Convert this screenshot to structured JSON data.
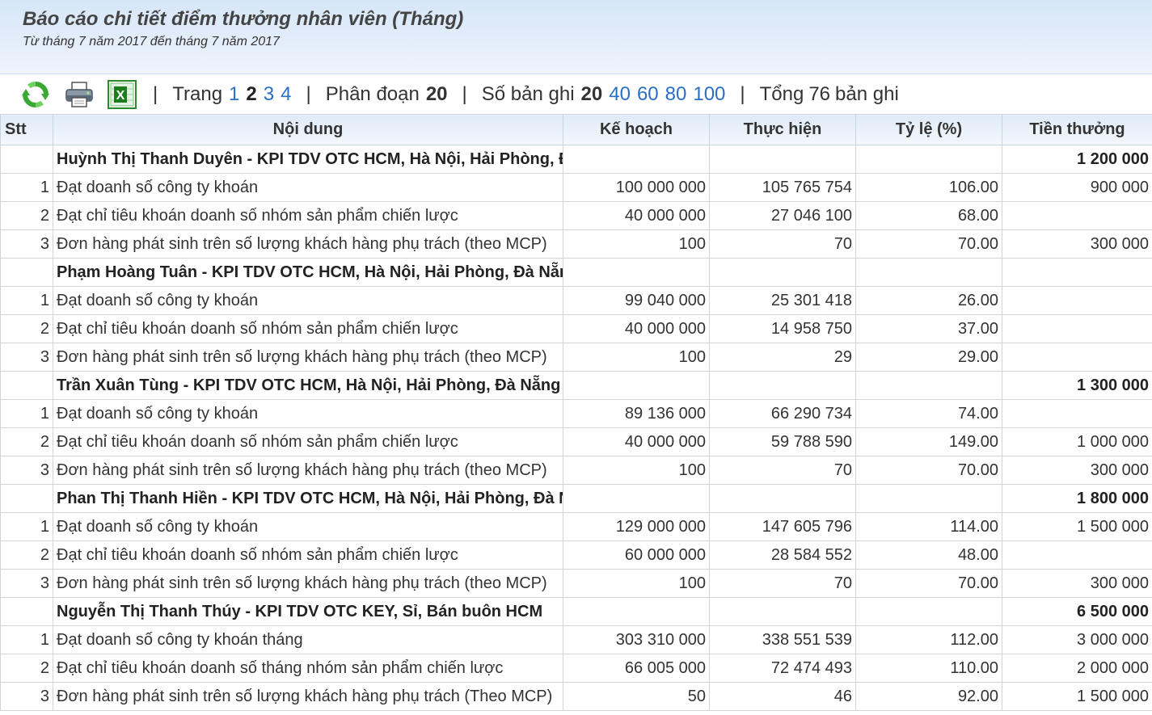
{
  "header": {
    "title": "Báo cáo chi tiết điểm thưởng nhân viên (Tháng)",
    "subtitle": "Từ tháng 7 năm 2017 đến tháng 7 năm 2017"
  },
  "toolbar": {
    "icons": [
      "refresh-icon",
      "print-icon",
      "excel-icon"
    ],
    "separator": "|",
    "page_label": "Trang",
    "pages": [
      "1",
      "2",
      "3",
      "4"
    ],
    "current_page": "2",
    "segment_label": "Phân đoạn",
    "segment_value": "20",
    "records_label": "Số bản ghi",
    "records_current": "20",
    "records_options": [
      "40",
      "60",
      "80",
      "100"
    ],
    "total_prefix": "Tổng",
    "total_count": "76",
    "total_suffix": "bản ghi"
  },
  "colors": {
    "link": "#2a70c2",
    "header_bg": "#dfeaf7",
    "grid": "#d4d4d4"
  },
  "table": {
    "columns": [
      "Stt",
      "Nội dung",
      "Kế hoạch",
      "Thực hiện",
      "Tỷ lệ (%)",
      "Tiền thưởng"
    ],
    "rows": [
      {
        "type": "group",
        "stt": "",
        "content": "Huỳnh Thị Thanh Duyên - KPI TDV OTC HCM, Hà Nội, Hải Phòng, Đà Nẵng",
        "plan": "",
        "actual": "",
        "rate": "",
        "bonus": "1 200 000"
      },
      {
        "type": "item",
        "stt": "1",
        "content": "Đạt doanh số công ty khoán",
        "plan": "100 000 000",
        "actual": "105 765 754",
        "rate": "106.00",
        "bonus": "900 000"
      },
      {
        "type": "item",
        "stt": "2",
        "content": "Đạt chỉ tiêu khoán doanh số nhóm sản phẩm chiến lược",
        "plan": "40 000 000",
        "actual": "27 046 100",
        "rate": "68.00",
        "bonus": ""
      },
      {
        "type": "item",
        "stt": "3",
        "content": "Đơn hàng phát sinh trên số lượng khách hàng phụ trách (theo MCP)",
        "plan": "100",
        "actual": "70",
        "rate": "70.00",
        "bonus": "300 000"
      },
      {
        "type": "group",
        "stt": "",
        "content": "Phạm Hoàng Tuân - KPI TDV OTC HCM, Hà Nội, Hải Phòng, Đà Nẵng",
        "plan": "",
        "actual": "",
        "rate": "",
        "bonus": ""
      },
      {
        "type": "item",
        "stt": "1",
        "content": "Đạt doanh số công ty khoán",
        "plan": "99 040 000",
        "actual": "25 301 418",
        "rate": "26.00",
        "bonus": ""
      },
      {
        "type": "item",
        "stt": "2",
        "content": "Đạt chỉ tiêu khoán doanh số nhóm sản phẩm chiến lược",
        "plan": "40 000 000",
        "actual": "14 958 750",
        "rate": "37.00",
        "bonus": ""
      },
      {
        "type": "item",
        "stt": "3",
        "content": "Đơn hàng phát sinh trên số lượng khách hàng phụ trách (theo MCP)",
        "plan": "100",
        "actual": "29",
        "rate": "29.00",
        "bonus": ""
      },
      {
        "type": "group",
        "stt": "",
        "content": "Trần Xuân Tùng - KPI TDV OTC HCM, Hà Nội, Hải Phòng, Đà Nẵng",
        "plan": "",
        "actual": "",
        "rate": "",
        "bonus": "1 300 000"
      },
      {
        "type": "item",
        "stt": "1",
        "content": "Đạt doanh số công ty khoán",
        "plan": "89 136 000",
        "actual": "66 290 734",
        "rate": "74.00",
        "bonus": ""
      },
      {
        "type": "item",
        "stt": "2",
        "content": "Đạt chỉ tiêu khoán doanh số nhóm sản phẩm chiến lược",
        "plan": "40 000 000",
        "actual": "59 788 590",
        "rate": "149.00",
        "bonus": "1 000 000"
      },
      {
        "type": "item",
        "stt": "3",
        "content": "Đơn hàng phát sinh trên số lượng khách hàng phụ trách (theo MCP)",
        "plan": "100",
        "actual": "70",
        "rate": "70.00",
        "bonus": "300 000"
      },
      {
        "type": "group",
        "stt": "",
        "content": "Phan Thị Thanh Hiền - KPI TDV OTC HCM, Hà Nội, Hải Phòng, Đà Nẵng",
        "plan": "",
        "actual": "",
        "rate": "",
        "bonus": "1 800 000"
      },
      {
        "type": "item",
        "stt": "1",
        "content": "Đạt doanh số công ty khoán",
        "plan": "129 000 000",
        "actual": "147 605 796",
        "rate": "114.00",
        "bonus": "1 500 000"
      },
      {
        "type": "item",
        "stt": "2",
        "content": "Đạt chỉ tiêu khoán doanh số nhóm sản phẩm chiến lược",
        "plan": "60 000 000",
        "actual": "28 584 552",
        "rate": "48.00",
        "bonus": ""
      },
      {
        "type": "item",
        "stt": "3",
        "content": "Đơn hàng phát sinh trên số lượng khách hàng phụ trách (theo MCP)",
        "plan": "100",
        "actual": "70",
        "rate": "70.00",
        "bonus": "300 000"
      },
      {
        "type": "group",
        "stt": "",
        "content": "Nguyễn Thị Thanh Thúy - KPI TDV OTC KEY, Sỉ, Bán buôn HCM",
        "plan": "",
        "actual": "",
        "rate": "",
        "bonus": "6 500 000"
      },
      {
        "type": "item",
        "stt": "1",
        "content": "Đạt doanh số công ty khoán tháng",
        "plan": "303 310 000",
        "actual": "338 551 539",
        "rate": "112.00",
        "bonus": "3 000 000"
      },
      {
        "type": "item",
        "stt": "2",
        "content": "Đạt chỉ tiêu khoán doanh số tháng nhóm sản phẩm chiến lược",
        "plan": "66 005 000",
        "actual": "72 474 493",
        "rate": "110.00",
        "bonus": "2 000 000"
      },
      {
        "type": "item",
        "stt": "3",
        "content": "Đơn hàng phát sinh trên số lượng khách hàng phụ trách (Theo MCP)",
        "plan": "50",
        "actual": "46",
        "rate": "92.00",
        "bonus": "1 500 000"
      }
    ]
  }
}
